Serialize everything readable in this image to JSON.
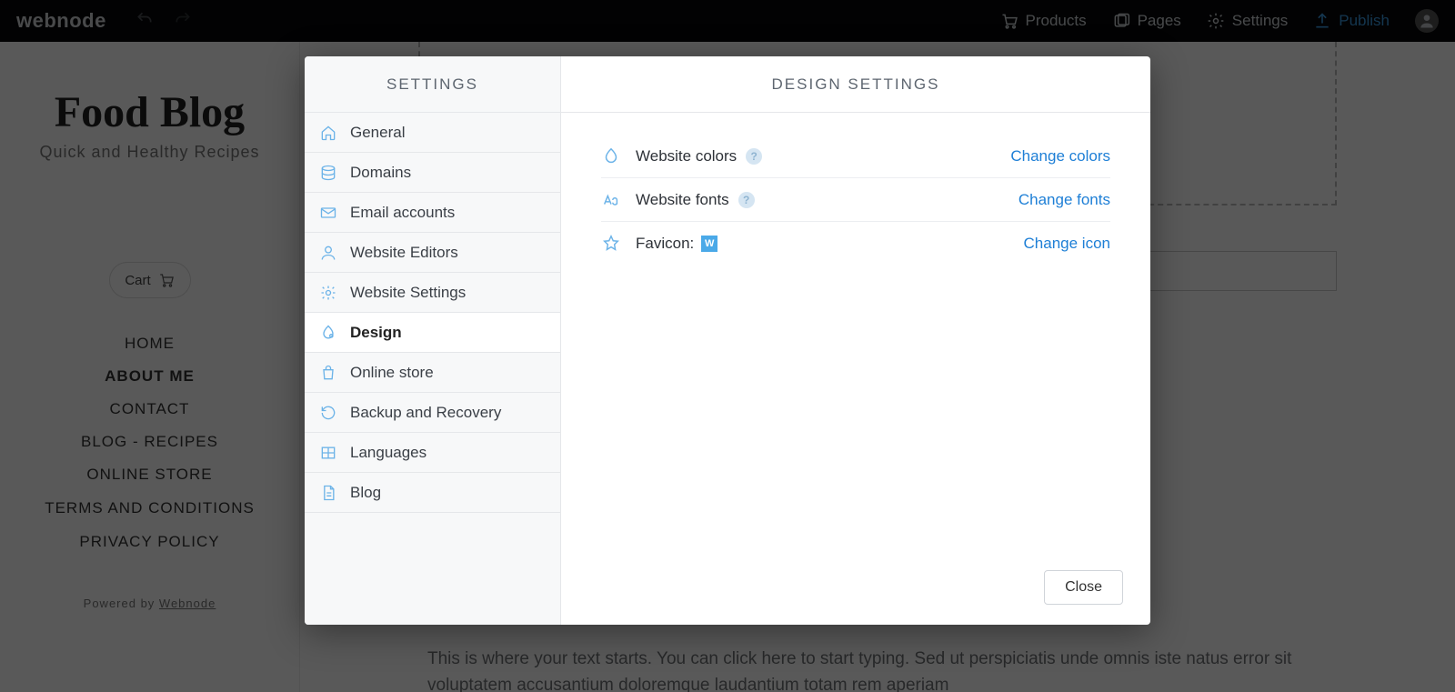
{
  "topbar": {
    "logo": "webnode",
    "products": "Products",
    "pages": "Pages",
    "settings": "Settings",
    "publish": "Publish"
  },
  "site": {
    "title": "Food Blog",
    "subtitle": "Quick and Healthy Recipes",
    "cart": "Cart",
    "nav": [
      "HOME",
      "ABOUT ME",
      "CONTACT",
      "BLOG - RECIPES",
      "ONLINE STORE",
      "TERMS AND CONDITIONS",
      "PRIVACY POLICY"
    ],
    "nav_active_index": 1,
    "powered_prefix": "Powered by ",
    "powered_brand": "Webnode",
    "paragraph": "This is where your text starts. You can click here to start typing. Sed ut perspiciatis unde omnis iste natus error sit voluptatem accusantium doloremque laudantium totam rem aperiam"
  },
  "modal": {
    "side_title": "SETTINGS",
    "main_title": "DESIGN SETTINGS",
    "items": [
      {
        "label": "General"
      },
      {
        "label": "Domains"
      },
      {
        "label": "Email accounts"
      },
      {
        "label": "Website Editors"
      },
      {
        "label": "Website Settings"
      },
      {
        "label": "Design"
      },
      {
        "label": "Online store"
      },
      {
        "label": "Backup and Recovery"
      },
      {
        "label": "Languages"
      },
      {
        "label": "Blog"
      }
    ],
    "selected_index": 5,
    "rows": {
      "colors": {
        "label": "Website colors",
        "link": "Change colors",
        "help": "?"
      },
      "fonts": {
        "label": "Website fonts",
        "link": "Change fonts",
        "help": "?"
      },
      "favicon": {
        "label": "Favicon:",
        "link": "Change icon",
        "badge": "W"
      }
    },
    "close": "Close"
  }
}
